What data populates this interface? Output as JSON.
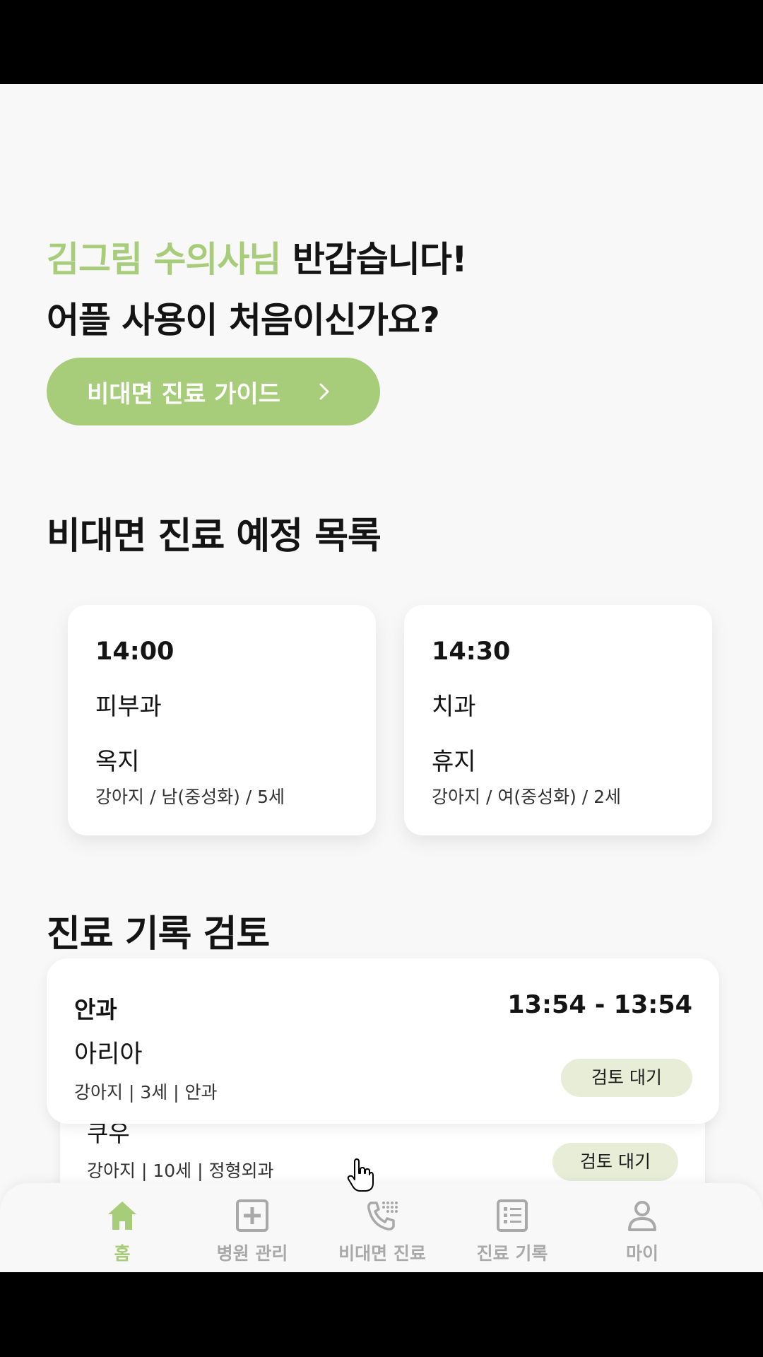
{
  "greeting": {
    "name": "김그림 수의사님",
    "line1_rest": " 반갑습니다!",
    "line2": "어플 사용이 처음이신가요?"
  },
  "guide_button": {
    "label": "비대면 진료 가이드",
    "icon": "chevron-right-icon"
  },
  "schedule": {
    "title": "비대면 진료 예정 목록",
    "items": [
      {
        "time": "14:00",
        "department": "피부과",
        "pet_name": "옥지",
        "info": "강아지 / 남(중성화) / 5세"
      },
      {
        "time": "14:30",
        "department": "치과",
        "pet_name": "휴지",
        "info": "강아지 / 여(중성화) / 2세"
      }
    ]
  },
  "records": {
    "title": "진료 기록 검토",
    "items": [
      {
        "department": "안과",
        "time_range": "13:54 - 13:54",
        "pet_name": "아리아",
        "info": "강아지 | 3세 | 안과",
        "status": "검토 대기"
      },
      {
        "pet_name": "쿠우",
        "info": "강아지 | 10세 | 정형외과",
        "status": "검토 대기"
      }
    ]
  },
  "tabbar": {
    "items": [
      {
        "label": "홈",
        "icon": "home-icon",
        "active": true
      },
      {
        "label": "병원 관리",
        "icon": "hospital-plus-icon",
        "active": false
      },
      {
        "label": "비대면 진료",
        "icon": "phone-dialpad-icon",
        "active": false
      },
      {
        "label": "진료 기록",
        "icon": "list-document-icon",
        "active": false
      },
      {
        "label": "마이",
        "icon": "user-icon",
        "active": false
      }
    ]
  },
  "colors": {
    "accent": "#a8cd7a",
    "badge_bg": "#e8edd8",
    "inactive": "#a9a9a9"
  }
}
